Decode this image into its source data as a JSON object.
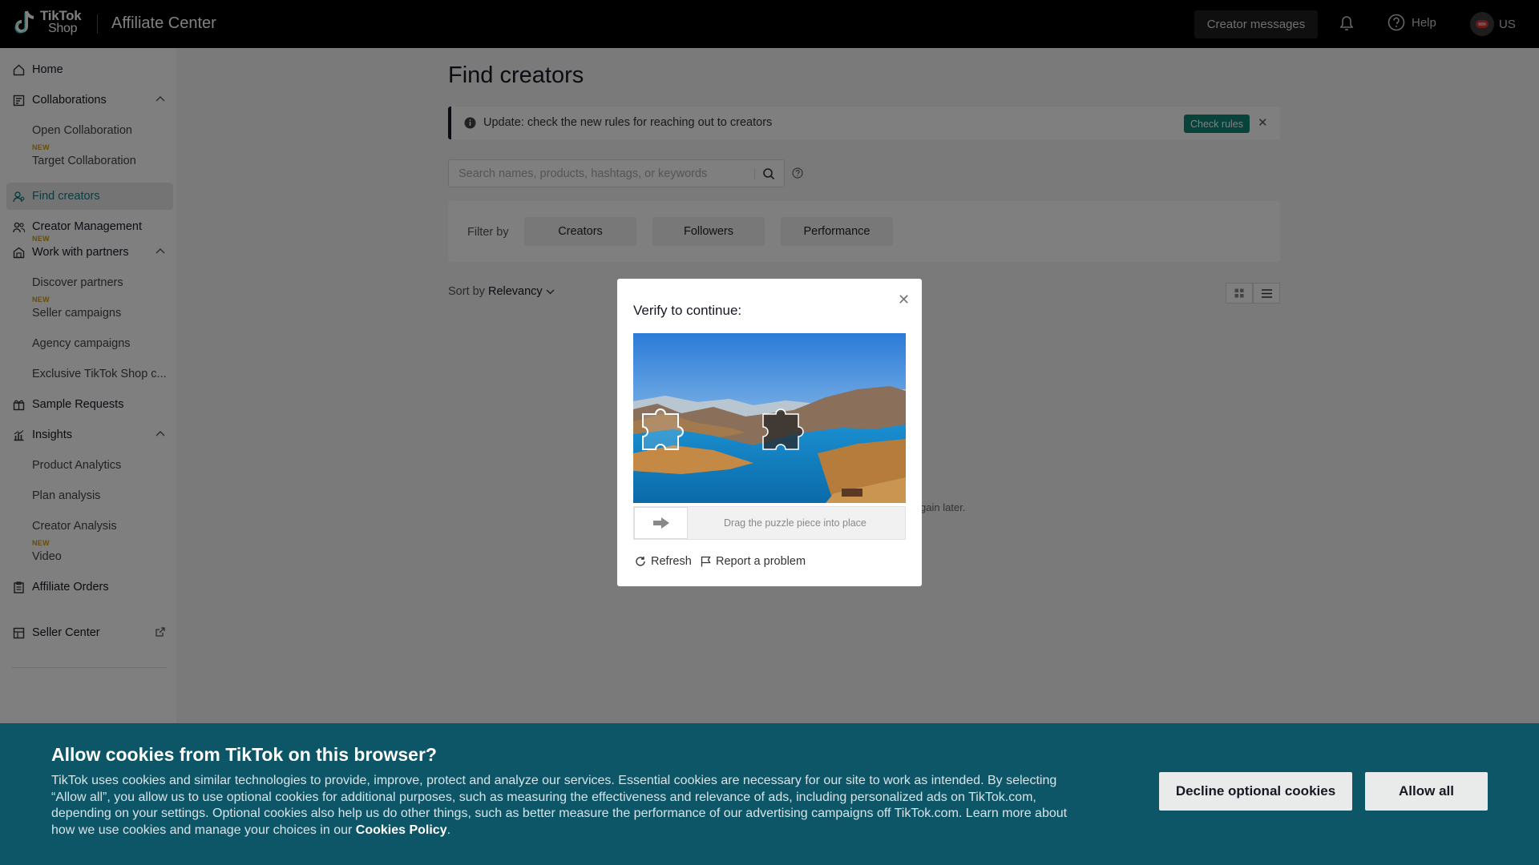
{
  "header": {
    "logo_line1": "TikTok",
    "logo_line2": "Shop",
    "app_title": "Affiliate Center",
    "creator_messages_label": "Creator messages",
    "help_label": "Help",
    "region_label": "US"
  },
  "sidebar": {
    "items": [
      {
        "label": "Home"
      },
      {
        "label": "Collaborations"
      },
      {
        "label": "Open Collaboration",
        "badge": "NEW"
      },
      {
        "label": "Target Collaboration"
      },
      {
        "label": "Find creators"
      },
      {
        "label": "Creator Management",
        "badge": "NEW"
      },
      {
        "label": "Work with partners"
      },
      {
        "label": "Discover partners",
        "badge": "NEW"
      },
      {
        "label": "Seller campaigns"
      },
      {
        "label": "Agency campaigns"
      },
      {
        "label": "Exclusive TikTok Shop c..."
      },
      {
        "label": "Sample Requests"
      },
      {
        "label": "Insights"
      },
      {
        "label": "Product Analytics"
      },
      {
        "label": "Plan analysis"
      },
      {
        "label": "Creator Analysis",
        "badge": "NEW"
      },
      {
        "label": "Video"
      },
      {
        "label": "Affiliate Orders"
      },
      {
        "label": "Seller Center"
      }
    ]
  },
  "main": {
    "page_title": "Find creators",
    "notice_text": "Update: check the new rules for reaching out to creators",
    "check_rules_label": "Check rules",
    "search_placeholder": "Search names, products, hashtags, or keywords",
    "filter_label": "Filter by",
    "filters": [
      "Creators",
      "Followers",
      "Performance"
    ],
    "sort_prefix": "Sort by",
    "sort_value": "Relevancy",
    "empty_hint_fragment": "gain later."
  },
  "captcha": {
    "title": "Verify to continue:",
    "drag_hint": "Drag the puzzle piece into place",
    "refresh_label": "Refresh",
    "report_label": "Report a problem"
  },
  "cookie_banner": {
    "title": "Allow cookies from TikTok on this browser?",
    "body": "TikTok uses cookies and similar technologies to provide, improve, protect and analyze our services. Essential cookies are necessary for our site to work as intended. By selecting “Allow all”, you allow us to use optional cookies for additional purposes, such as measuring the effectiveness and relevance of ads, including personalized ads on TikTok.com, depending on your settings. Optional cookies also help us do other things, such as better measure the performance of our advertising campaigns off TikTok.com. Learn more about how we use cookies and manage your choices in our",
    "policy_link": "Cookies Policy",
    "body_end": ".",
    "decline_label": "Decline optional cookies",
    "allow_label": "Allow all"
  },
  "colors": {
    "accent_teal": "#0f8577",
    "cookie_bg": "#0d5668",
    "new_badge": "#c99a17"
  }
}
